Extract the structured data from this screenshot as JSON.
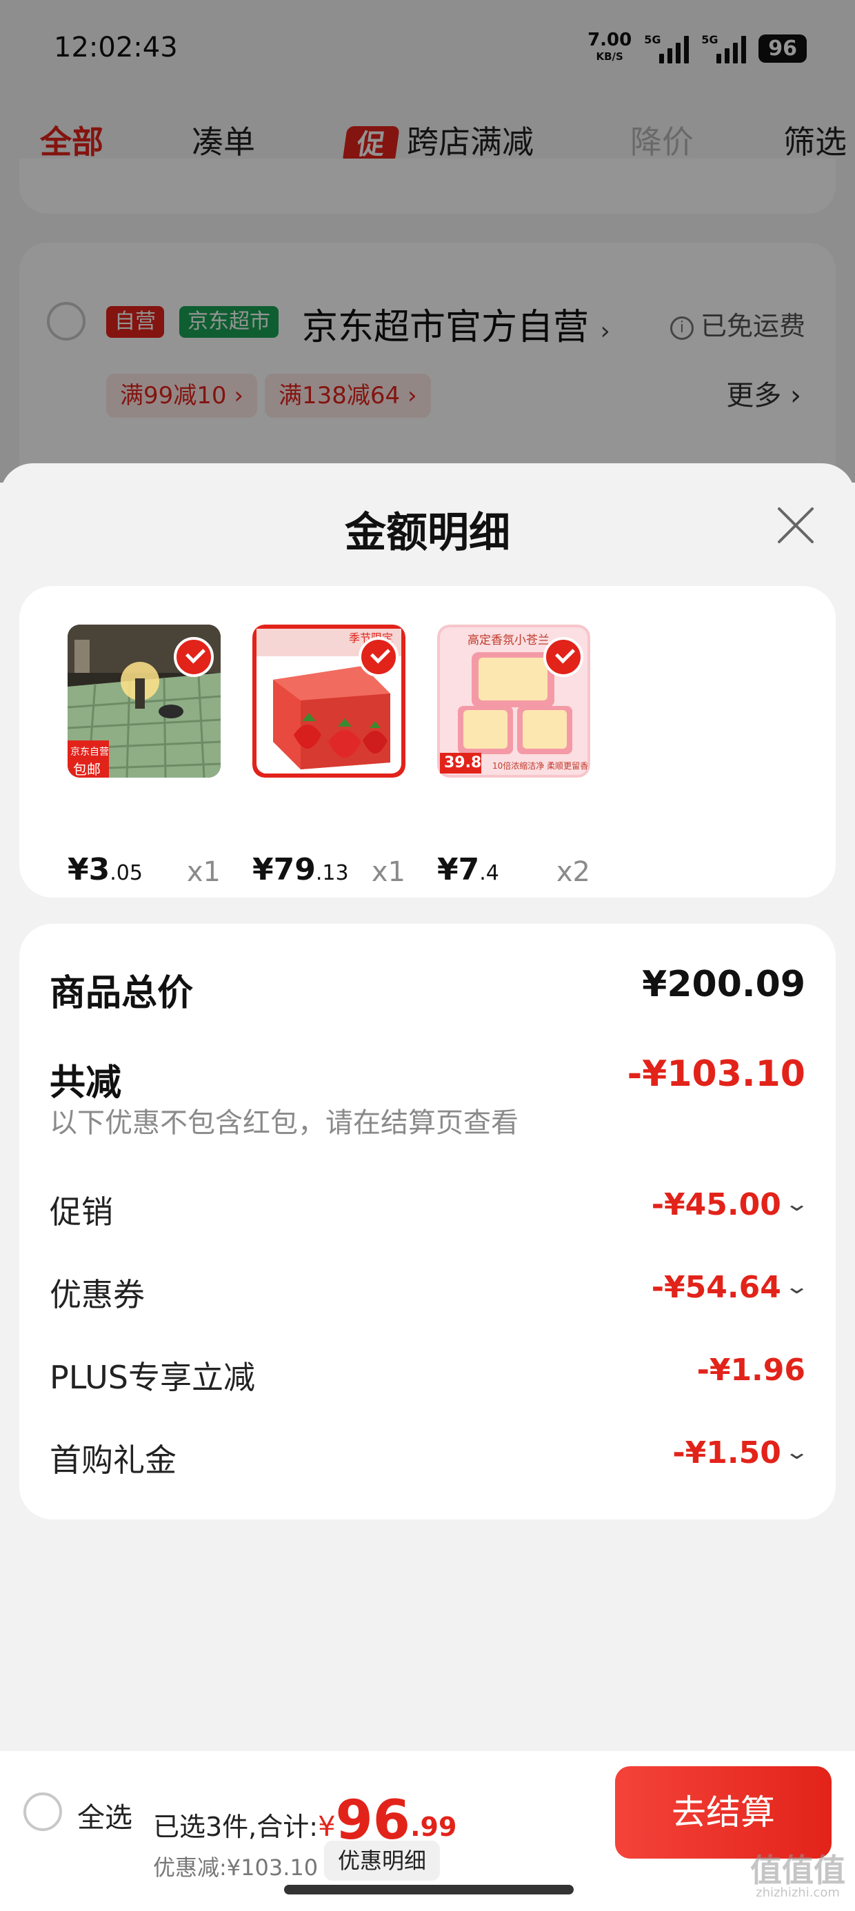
{
  "status_bar": {
    "time": "12:02:43",
    "net_speed": "7.00",
    "net_unit": "KB/S",
    "sim1": "5G",
    "sim2": "5G",
    "battery": "96"
  },
  "tabs": [
    {
      "label": "全部",
      "state": "active"
    },
    {
      "label": "凑单",
      "state": "normal"
    },
    {
      "label": "跨店满减",
      "badge": "促",
      "state": "normal"
    },
    {
      "label": "降价",
      "state": "disabled"
    },
    {
      "label": "筛选",
      "state": "normal"
    }
  ],
  "shop": {
    "tag_self": "自营",
    "tag_market": "京东超市",
    "name": "京东超市官方自营",
    "name_arrow": "›",
    "shipping": "已免运费",
    "info_icon": "i",
    "coupons": [
      "满99减10 ›",
      "满138减64 ›"
    ],
    "more": "更多 ›"
  },
  "sheet": {
    "title": "金额明细",
    "products": [
      {
        "price_int": "¥3",
        "price_dec": ".05",
        "qty": "x1",
        "image": "tablecloth-photo",
        "image_badge_1": "京东自营",
        "image_badge_2": "包邮"
      },
      {
        "price_int": "¥79",
        "price_dec": ".13",
        "qty": "x1",
        "image": "strawberry-box-photo",
        "image_badge_1": "季节限定"
      },
      {
        "price_int": "¥7",
        "price_dec": ".4",
        "qty": "x2",
        "image": "air-freshener-photo",
        "image_badge_1": "高定香氛小苍兰",
        "image_badge_2": "39.8",
        "image_badge_3": "10倍浓缩洁净 柔顺更留香"
      }
    ],
    "summary": {
      "subtotal_label": "商品总价",
      "subtotal_value": "¥200.09",
      "total_discount_label": "共减",
      "total_discount_value": "-¥103.10",
      "note": "以下优惠不包含红包，请在结算页查看",
      "items": [
        {
          "label": "促销",
          "value": "-¥45.00",
          "expandable": true
        },
        {
          "label": "优惠券",
          "value": "-¥54.64",
          "expandable": true
        },
        {
          "label": "PLUS专享立减",
          "value": "-¥1.96",
          "expandable": false
        },
        {
          "label": "首购礼金",
          "value": "-¥1.50",
          "expandable": true
        }
      ]
    }
  },
  "bottom_bar": {
    "select_all": "全选",
    "selected_text": "已选3件,合计:",
    "currency": "¥",
    "total_int": "96",
    "total_dec": ".99",
    "discount_text": "优惠减:¥103.10",
    "detail_button": "优惠明细",
    "checkout_button": "去结算"
  },
  "watermark": {
    "text": "值值值",
    "sub": "zhizhizhi.com"
  },
  "colors": {
    "accent": "#e2231a",
    "market_green": "#1aa356",
    "text_gray": "#8a8a8a"
  }
}
